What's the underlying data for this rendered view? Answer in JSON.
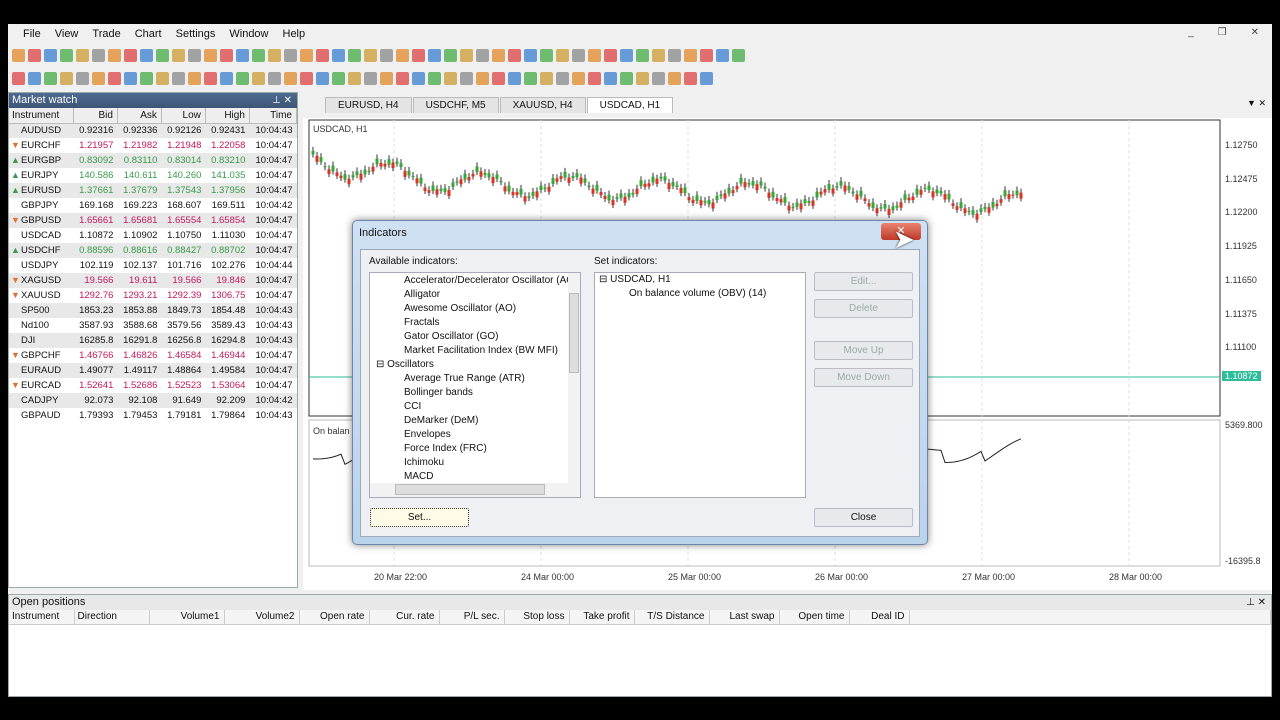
{
  "menu": [
    "File",
    "View",
    "Trade",
    "Chart",
    "Settings",
    "Window",
    "Help"
  ],
  "market_watch": {
    "title": "Market watch",
    "columns": [
      "Instrument",
      "Bid",
      "Ask",
      "Low",
      "High",
      "Time"
    ],
    "rows": [
      [
        "",
        "AUDUSD",
        "0.92316",
        "0.92336",
        "0.92126",
        "0.92431",
        "10:04:43"
      ],
      [
        "dn",
        "EURCHF",
        "1.21957",
        "1.21982",
        "1.21948",
        "1.22058",
        "10:04:47"
      ],
      [
        "up",
        "EURGBP",
        "0.83092",
        "0.83110",
        "0.83014",
        "0.83210",
        "10:04:47"
      ],
      [
        "up",
        "EURJPY",
        "140.586",
        "140.611",
        "140.260",
        "141.035",
        "10:04:47"
      ],
      [
        "up",
        "EURUSD",
        "1.37661",
        "1.37679",
        "1.37543",
        "1.37956",
        "10:04:47"
      ],
      [
        "",
        "GBPJPY",
        "169.168",
        "169.223",
        "168.607",
        "169.511",
        "10:04:42"
      ],
      [
        "dn",
        "GBPUSD",
        "1.65661",
        "1.65681",
        "1.65554",
        "1.65854",
        "10:04:47"
      ],
      [
        "",
        "USDCAD",
        "1.10872",
        "1.10902",
        "1.10750",
        "1.11030",
        "10:04:47"
      ],
      [
        "up",
        "USDCHF",
        "0.88596",
        "0.88616",
        "0.88427",
        "0.88702",
        "10:04:47"
      ],
      [
        "",
        "USDJPY",
        "102.119",
        "102.137",
        "101.716",
        "102.276",
        "10:04:44"
      ],
      [
        "dn",
        "XAGUSD",
        "19.566",
        "19.611",
        "19.566",
        "19.846",
        "10:04:47"
      ],
      [
        "dn",
        "XAUUSD",
        "1292.76",
        "1293.21",
        "1292.39",
        "1306.75",
        "10:04:47"
      ],
      [
        "",
        "SP500",
        "1853.23",
        "1853.88",
        "1849.73",
        "1854.48",
        "10:04:43"
      ],
      [
        "",
        "Nd100",
        "3587.93",
        "3588.68",
        "3579.56",
        "3589.43",
        "10:04:43"
      ],
      [
        "",
        "DJI",
        "16285.8",
        "16291.8",
        "16256.8",
        "16294.8",
        "10:04:43"
      ],
      [
        "dn",
        "GBPCHF",
        "1.46766",
        "1.46826",
        "1.46584",
        "1.46944",
        "10:04:47"
      ],
      [
        "",
        "EURAUD",
        "1.49077",
        "1.49117",
        "1.48864",
        "1.49584",
        "10:04:47"
      ],
      [
        "dn",
        "EURCAD",
        "1.52641",
        "1.52686",
        "1.52523",
        "1.53064",
        "10:04:47"
      ],
      [
        "",
        "CADJPY",
        "92.073",
        "92.108",
        "91.649",
        "92.209",
        "10:04:42"
      ],
      [
        "",
        "GBPAUD",
        "1.79393",
        "1.79453",
        "1.79181",
        "1.79864",
        "10:04:43"
      ]
    ]
  },
  "chart_tabs": [
    "EURUSD, H4",
    "USDCHF, M5",
    "XAUUSD, H4",
    "USDCAD, H1"
  ],
  "chart": {
    "label": "USDCAD, H1",
    "sub_label": "On balan",
    "price_ticks": [
      "1.12750",
      "1.12475",
      "1.12200",
      "1.11925",
      "1.11650",
      "1.11375",
      "1.11100"
    ],
    "current_price": "1.10872",
    "sub_ticks": [
      "5369.800",
      "-16395.8"
    ],
    "time_ticks": [
      "20 Mar 22:00",
      "24 Mar 00:00",
      "25 Mar 00:00",
      "26 Mar 00:00",
      "27 Mar 00:00",
      "28 Mar 00:00"
    ]
  },
  "dialog": {
    "title": "Indicators",
    "available_label": "Available indicators:",
    "set_label": "Set indicators:",
    "available": [
      [
        "c",
        "Accelerator/Decelerator Oscillator (AC"
      ],
      [
        "c",
        "Alligator"
      ],
      [
        "c",
        "Awesome Oscillator (AO)"
      ],
      [
        "c",
        "Fractals"
      ],
      [
        "c",
        "Gator Oscillator (GO)"
      ],
      [
        "c",
        "Market Facilitation Index (BW MFI)"
      ],
      [
        "g",
        "Oscillators"
      ],
      [
        "c",
        "Average True Range (ATR)"
      ],
      [
        "c",
        "Bollinger bands"
      ],
      [
        "c",
        "CCI"
      ],
      [
        "c",
        "DeMarker (DeM)"
      ],
      [
        "c",
        "Envelopes"
      ],
      [
        "c",
        "Force Index (FRC)"
      ],
      [
        "c",
        "Ichimoku"
      ],
      [
        "c",
        "MACD"
      ]
    ],
    "set_root": "USDCAD, H1",
    "set_child": "On balance volume (OBV) (14)",
    "buttons": {
      "edit": "Edit...",
      "delete": "Delete",
      "move_up": "Move Up",
      "move_down": "Move Down",
      "set": "Set...",
      "close": "Close"
    }
  },
  "open_positions": {
    "title": "Open positions",
    "columns": [
      "Instrument",
      "Direction",
      "Volume1",
      "Volume2",
      "Open rate",
      "Cur. rate",
      "P/L sec.",
      "Stop loss",
      "Take profit",
      "T/S Distance",
      "Last swap",
      "Open time",
      "Deal ID"
    ]
  }
}
